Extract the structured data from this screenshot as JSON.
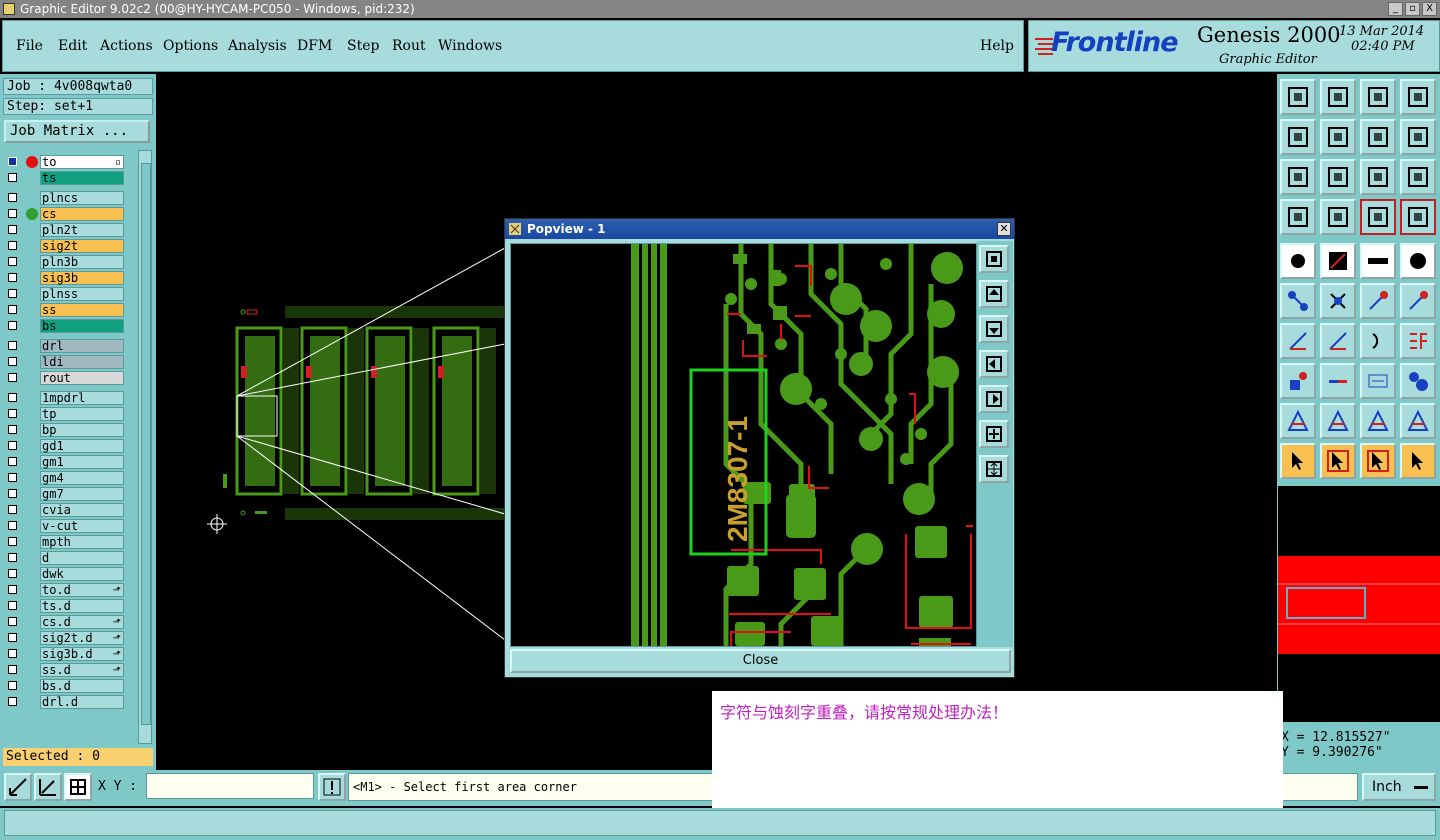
{
  "window": {
    "title": "Graphic Editor 9.02c2 (00@HY-HYCAM-PC050 - Windows, pid:232)",
    "buttons": [
      "_",
      "▫",
      "X"
    ]
  },
  "menu": {
    "items": [
      "File",
      "Edit",
      "Actions",
      "Options",
      "Analysis",
      "DFM",
      "Step",
      "Rout",
      "Windows"
    ],
    "help": "Help"
  },
  "brand": {
    "logo": "Frontline",
    "product": "Genesis 2000",
    "subtitle": "Graphic Editor",
    "date": "13 Mar 2014",
    "time": "02:40 PM"
  },
  "job": {
    "job_label": "Job : 4v008qwta0",
    "step_label": "Step: set+1",
    "matrix_button": "Job Matrix ..."
  },
  "layers": [
    {
      "name": "to",
      "color": "#ffffff",
      "dot": "#e01010",
      "checked": true,
      "mark": "▫"
    },
    {
      "name": "ts",
      "color": "#10a080",
      "dot": "",
      "checked": false,
      "mark": ""
    },
    {
      "name": "plncs",
      "color": "#a8dcdc",
      "dot": "",
      "checked": false,
      "mark": ""
    },
    {
      "name": "cs",
      "color": "#f8c050",
      "dot": "#30a030",
      "checked": false,
      "mark": ""
    },
    {
      "name": "pln2t",
      "color": "#a8dcdc",
      "dot": "",
      "checked": false,
      "mark": ""
    },
    {
      "name": "sig2t",
      "color": "#f8c050",
      "dot": "",
      "checked": false,
      "mark": ""
    },
    {
      "name": "pln3b",
      "color": "#a8dcdc",
      "dot": "",
      "checked": false,
      "mark": ""
    },
    {
      "name": "sig3b",
      "color": "#f8c050",
      "dot": "",
      "checked": false,
      "mark": ""
    },
    {
      "name": "plnss",
      "color": "#a8dcdc",
      "dot": "",
      "checked": false,
      "mark": ""
    },
    {
      "name": "ss",
      "color": "#f8c050",
      "dot": "",
      "checked": false,
      "mark": ""
    },
    {
      "name": "bs",
      "color": "#10a080",
      "dot": "",
      "checked": false,
      "mark": ""
    },
    {
      "name": "drl",
      "color": "#a0b8c0",
      "dot": "",
      "checked": false,
      "mark": ""
    },
    {
      "name": "ldi",
      "color": "#a0b8c0",
      "dot": "",
      "checked": false,
      "mark": ""
    },
    {
      "name": "rout",
      "color": "#d8d8d8",
      "dot": "",
      "checked": false,
      "mark": ""
    },
    {
      "name": "1mpdrl",
      "color": "#a8dcdc",
      "dot": "",
      "checked": false,
      "mark": ""
    },
    {
      "name": "tp",
      "color": "#a8dcdc",
      "dot": "",
      "checked": false,
      "mark": ""
    },
    {
      "name": "bp",
      "color": "#a8dcdc",
      "dot": "",
      "checked": false,
      "mark": ""
    },
    {
      "name": "gd1",
      "color": "#a8dcdc",
      "dot": "",
      "checked": false,
      "mark": ""
    },
    {
      "name": "gm1",
      "color": "#a8dcdc",
      "dot": "",
      "checked": false,
      "mark": ""
    },
    {
      "name": "gm4",
      "color": "#a8dcdc",
      "dot": "",
      "checked": false,
      "mark": ""
    },
    {
      "name": "gm7",
      "color": "#a8dcdc",
      "dot": "",
      "checked": false,
      "mark": ""
    },
    {
      "name": "cvia",
      "color": "#a8dcdc",
      "dot": "",
      "checked": false,
      "mark": ""
    },
    {
      "name": "v-cut",
      "color": "#a8dcdc",
      "dot": "",
      "checked": false,
      "mark": ""
    },
    {
      "name": "mpth",
      "color": "#a8dcdc",
      "dot": "",
      "checked": false,
      "mark": ""
    },
    {
      "name": "d",
      "color": "#a8dcdc",
      "dot": "",
      "checked": false,
      "mark": ""
    },
    {
      "name": "dwk",
      "color": "#a8dcdc",
      "dot": "",
      "checked": false,
      "mark": ""
    },
    {
      "name": "to.d",
      "color": "#a8dcdc",
      "dot": "",
      "checked": false,
      "mark": "⬏"
    },
    {
      "name": "ts.d",
      "color": "#a8dcdc",
      "dot": "",
      "checked": false,
      "mark": ""
    },
    {
      "name": "cs.d",
      "color": "#a8dcdc",
      "dot": "",
      "checked": false,
      "mark": "⬏"
    },
    {
      "name": "sig2t.d",
      "color": "#a8dcdc",
      "dot": "",
      "checked": false,
      "mark": "⬏"
    },
    {
      "name": "sig3b.d",
      "color": "#a8dcdc",
      "dot": "",
      "checked": false,
      "mark": "⬏"
    },
    {
      "name": "ss.d",
      "color": "#a8dcdc",
      "dot": "",
      "checked": false,
      "mark": "⬏"
    },
    {
      "name": "bs.d",
      "color": "#a8dcdc",
      "dot": "",
      "checked": false,
      "mark": ""
    },
    {
      "name": "drl.d",
      "color": "#a8dcdc",
      "dot": "",
      "checked": false,
      "mark": ""
    }
  ],
  "selected": "Selected : 0",
  "popview": {
    "title": "Popview - 1",
    "close_label": "Close",
    "marking_text": "2M8307-1"
  },
  "coords": {
    "x": "X = 12.815527\"",
    "y": "Y = 9.390276\""
  },
  "bottom": {
    "xy_label": "X Y :",
    "xy_value": "",
    "prompt": "<M1> - Select first area corner",
    "unit": "Inch"
  },
  "note": "字符与蚀刻字重叠，请按常规处理办法！",
  "colors": {
    "copper": "#4a9a1a",
    "highlight": "#20d020",
    "silkscreen": "#c8a030",
    "outline_red": "#e01010",
    "panel": "#7fc8c8",
    "note_text": "#c020c0"
  }
}
